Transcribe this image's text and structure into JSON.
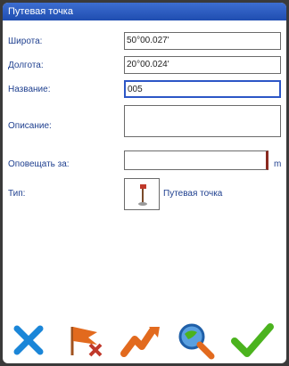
{
  "window": {
    "title": "Путевая точка"
  },
  "form": {
    "latitude_label": "Широта:",
    "latitude_value": "50°00.027'",
    "longitude_label": "Долгота:",
    "longitude_value": "20°00.024'",
    "name_label": "Название:",
    "name_value": "005",
    "description_label": "Описание:",
    "description_value": "",
    "notify_label": "Оповещать за:",
    "notify_value": "",
    "notify_unit": "m",
    "type_label": "Тип:",
    "type_value": "Путевая точка"
  },
  "toolbar": {
    "items": [
      {
        "icon": "close-x-icon",
        "color": "#1b86d8"
      },
      {
        "icon": "flag-delete-icon",
        "color": "#e26a1e"
      },
      {
        "icon": "route-icon",
        "color": "#e26a1e"
      },
      {
        "icon": "search-globe-icon",
        "color": "#2a6fc0"
      },
      {
        "icon": "checkmark-icon",
        "color": "#4bb31e"
      }
    ]
  }
}
